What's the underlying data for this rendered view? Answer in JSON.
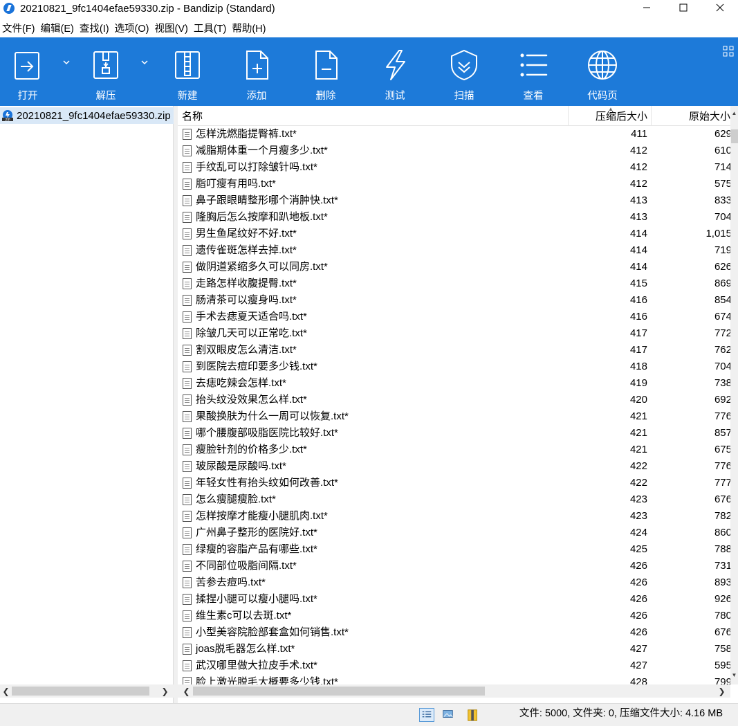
{
  "window": {
    "title": "20210821_9fc1404efae59330.zip - Bandizip (Standard)",
    "minimize": "—",
    "maximize": "☐",
    "close": "✕"
  },
  "menu": [
    "文件(F)",
    "编辑(E)",
    "查找(I)",
    "选项(O)",
    "视图(V)",
    "工具(T)",
    "帮助(H)"
  ],
  "toolbar": {
    "open": "打开",
    "extract": "解压",
    "new": "新建",
    "add": "添加",
    "delete": "删除",
    "test": "测试",
    "scan": "扫描",
    "view": "查看",
    "codepage": "代码页"
  },
  "colors": {
    "toolbar": "#1d7ad9",
    "selection": "#d9e8f7"
  },
  "tree": {
    "root": "20210821_9fc1404efae59330.zip"
  },
  "columns": {
    "name": "名称",
    "compressed": "压缩后大小",
    "original": "原始大小"
  },
  "files": [
    {
      "name": "怎样洗燃脂提臀裤.txt*",
      "compressed": "411",
      "original": "629"
    },
    {
      "name": "减脂期体重一个月瘦多少.txt*",
      "compressed": "412",
      "original": "610"
    },
    {
      "name": "手纹乱可以打除皱针吗.txt*",
      "compressed": "412",
      "original": "714"
    },
    {
      "name": "脂叮瘦有用吗.txt*",
      "compressed": "412",
      "original": "575"
    },
    {
      "name": "鼻子跟眼睛整形哪个消肿快.txt*",
      "compressed": "413",
      "original": "833"
    },
    {
      "name": "隆胸后怎么按摩和趴地板.txt*",
      "compressed": "413",
      "original": "704"
    },
    {
      "name": "男生鱼尾纹好不好.txt*",
      "compressed": "414",
      "original": "1,015"
    },
    {
      "name": "遗传雀斑怎样去掉.txt*",
      "compressed": "414",
      "original": "719"
    },
    {
      "name": "做阴道紧缩多久可以同房.txt*",
      "compressed": "414",
      "original": "626"
    },
    {
      "name": "走路怎样收腹提臀.txt*",
      "compressed": "415",
      "original": "869"
    },
    {
      "name": "肠清茶可以瘦身吗.txt*",
      "compressed": "416",
      "original": "854"
    },
    {
      "name": "手术去痣夏天适合吗.txt*",
      "compressed": "416",
      "original": "674"
    },
    {
      "name": "除皱几天可以正常吃.txt*",
      "compressed": "417",
      "original": "772"
    },
    {
      "name": "割双眼皮怎么清洁.txt*",
      "compressed": "417",
      "original": "762"
    },
    {
      "name": "到医院去痘印要多少钱.txt*",
      "compressed": "418",
      "original": "704"
    },
    {
      "name": "去痣吃辣会怎样.txt*",
      "compressed": "419",
      "original": "738"
    },
    {
      "name": "抬头纹没效果怎么样.txt*",
      "compressed": "420",
      "original": "692"
    },
    {
      "name": "果酸换肤为什么一周可以恢复.txt*",
      "compressed": "421",
      "original": "776"
    },
    {
      "name": "哪个腰腹部吸脂医院比较好.txt*",
      "compressed": "421",
      "original": "857"
    },
    {
      "name": "瘦脸针剂的价格多少.txt*",
      "compressed": "421",
      "original": "675"
    },
    {
      "name": "玻尿酸是尿酸吗.txt*",
      "compressed": "422",
      "original": "776"
    },
    {
      "name": "年轻女性有抬头纹如何改善.txt*",
      "compressed": "422",
      "original": "777"
    },
    {
      "name": "怎么瘦腿瘦脸.txt*",
      "compressed": "423",
      "original": "676"
    },
    {
      "name": "怎样按摩才能瘦小腿肌肉.txt*",
      "compressed": "423",
      "original": "782"
    },
    {
      "name": "广州鼻子整形的医院好.txt*",
      "compressed": "424",
      "original": "860"
    },
    {
      "name": "绿瘦的容脂产品有哪些.txt*",
      "compressed": "425",
      "original": "788"
    },
    {
      "name": "不同部位吸脂间隔.txt*",
      "compressed": "426",
      "original": "731"
    },
    {
      "name": "苦参去痘吗.txt*",
      "compressed": "426",
      "original": "893"
    },
    {
      "name": "揉捏小腿可以瘦小腿吗.txt*",
      "compressed": "426",
      "original": "926"
    },
    {
      "name": "维生素c可以去斑.txt*",
      "compressed": "426",
      "original": "780"
    },
    {
      "name": "小型美容院脸部套盒如何销售.txt*",
      "compressed": "426",
      "original": "676"
    },
    {
      "name": "joas脱毛器怎么样.txt*",
      "compressed": "427",
      "original": "758"
    },
    {
      "name": "武汉哪里做大拉皮手术.txt*",
      "compressed": "427",
      "original": "595"
    },
    {
      "name": "脸上激光脱毛大概要多少钱.txt*",
      "compressed": "428",
      "original": "799"
    }
  ],
  "status": {
    "text": "文件: 5000, 文件夹: 0, 压缩文件大小: 4.16 MB"
  }
}
